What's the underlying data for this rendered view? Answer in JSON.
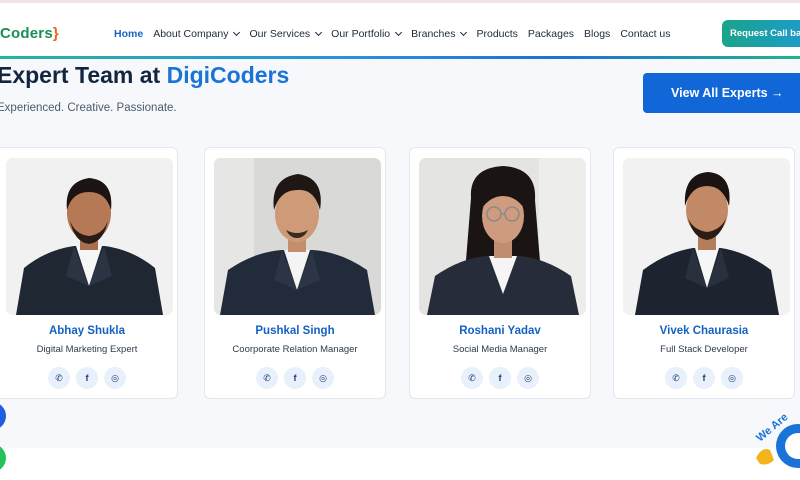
{
  "navbar": {
    "logo_text": "Coders",
    "logo_brace": "}",
    "links": [
      "Home",
      "About Company",
      "Our Services",
      "Our Portfolio",
      "Branches",
      "Products",
      "Packages",
      "Blogs",
      "Contact us"
    ],
    "cta_label": "Request Call back"
  },
  "section": {
    "heading_prefix": "Expert Team at ",
    "heading_accent": "DigiCoders",
    "subheading": "Experienced. Creative. Passionate.",
    "view_all_label": "View All Experts →"
  },
  "team": [
    {
      "name": "Abhay Shukla",
      "role": "Digital Marketing Expert"
    },
    {
      "name": "Pushkal Singh",
      "role": "Coorporate Relation Manager"
    },
    {
      "name": "Roshani Yadav",
      "role": "Social Media Manager"
    },
    {
      "name": "Vivek Chaurasia",
      "role": "Full Stack Developer"
    }
  ],
  "socials": {
    "whatsapp": "✆",
    "facebook": "f",
    "instagram": "◎"
  },
  "chat_badge_text": "We Are",
  "colors": {
    "accent": "#1a73d9",
    "primary_button": "#1167d8",
    "heading": "#13263f"
  }
}
